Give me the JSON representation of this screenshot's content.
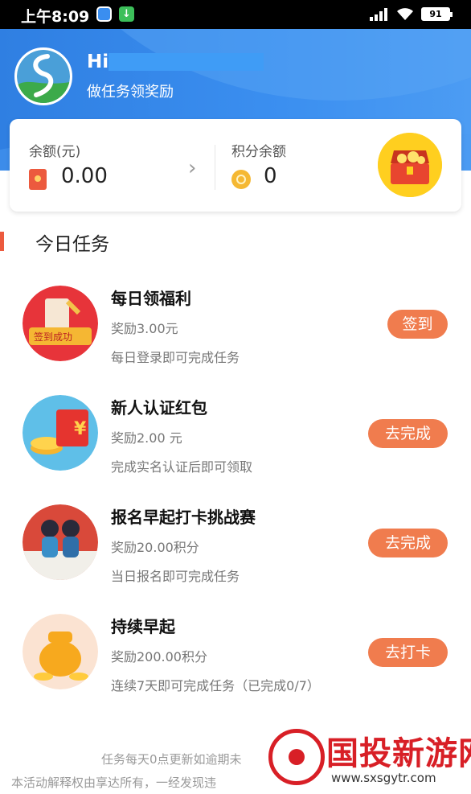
{
  "status_bar": {
    "time": "上午8:09",
    "battery": "91"
  },
  "header": {
    "greeting": "Hi,",
    "subtitle": "做任务领奖励"
  },
  "balance_card": {
    "balance_label": "余额(元)",
    "balance_value": "0.00",
    "points_label": "积分余额",
    "points_value": "0"
  },
  "section": {
    "title": "今日任务"
  },
  "tasks": [
    {
      "title": "每日领福利",
      "reward": "奖励3.00元",
      "desc": "每日登录即可完成任务",
      "button": "签到",
      "thumb_text": "签到成功"
    },
    {
      "title": "新人认证红包",
      "reward": "奖励2.00 元",
      "desc": "完成实名认证后即可领取",
      "button": "去完成",
      "thumb_text": "¥"
    },
    {
      "title": "报名早起打卡挑战赛",
      "reward": "奖励20.00积分",
      "desc": "当日报名即可完成任务",
      "button": "去完成"
    },
    {
      "title": "持续早起",
      "reward": "奖励200.00积分",
      "desc": "连续7天即可完成任务（已完成0/7）",
      "button": "去打卡"
    }
  ],
  "footer": {
    "line1": "任务每天0点更新如逾期未",
    "line2": "本活动解释权由享达所有，一经发现违"
  },
  "watermark": {
    "title": "国投新游网",
    "url": "www.sxsgytr.com"
  },
  "colors": {
    "header_blue": "#3b8ff0",
    "button_orange": "#f07c4e",
    "accent_red": "#ec5a3e"
  }
}
